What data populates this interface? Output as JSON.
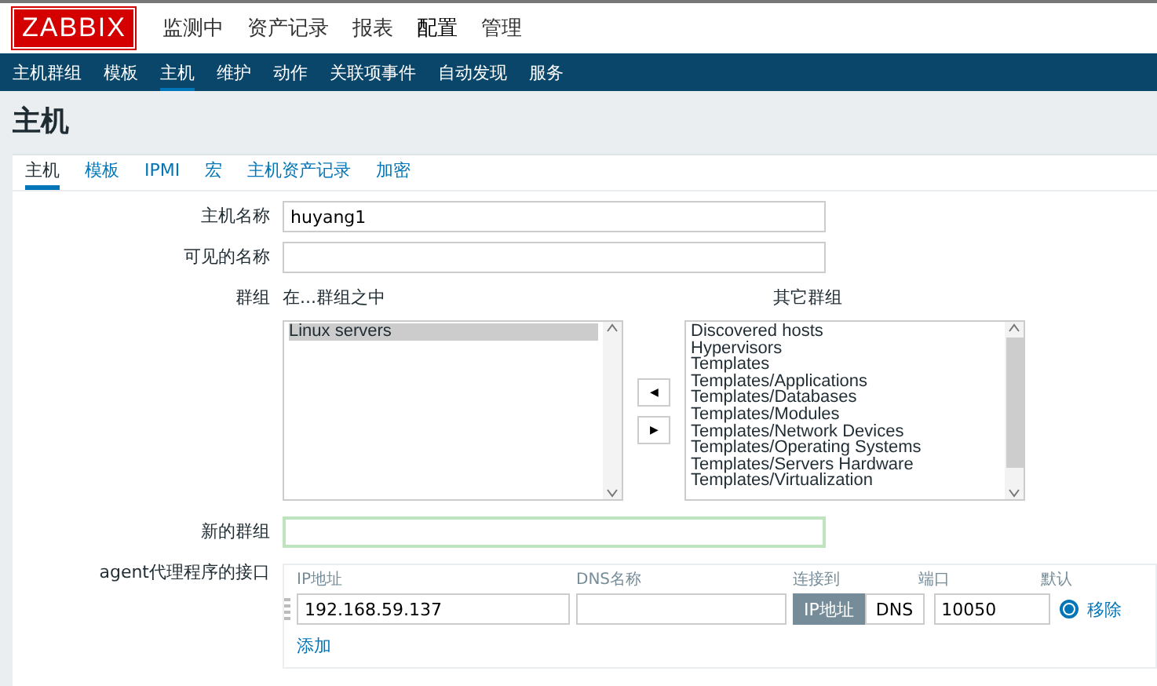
{
  "logo": "ZABBIX",
  "main_menu": [
    {
      "label": "监测中",
      "selected": false
    },
    {
      "label": "资产记录",
      "selected": false
    },
    {
      "label": "报表",
      "selected": false
    },
    {
      "label": "配置",
      "selected": true
    },
    {
      "label": "管理",
      "selected": false
    }
  ],
  "sub_menu": [
    {
      "label": "主机群组",
      "selected": false
    },
    {
      "label": "模板",
      "selected": false
    },
    {
      "label": "主机",
      "selected": true
    },
    {
      "label": "维护",
      "selected": false
    },
    {
      "label": "动作",
      "selected": false
    },
    {
      "label": "关联项事件",
      "selected": false
    },
    {
      "label": "自动发现",
      "selected": false
    },
    {
      "label": "服务",
      "selected": false
    }
  ],
  "page_title": "主机",
  "tabs": [
    {
      "label": "主机",
      "selected": true
    },
    {
      "label": "模板",
      "selected": false
    },
    {
      "label": "IPMI",
      "selected": false
    },
    {
      "label": "宏",
      "selected": false
    },
    {
      "label": "主机资产记录",
      "selected": false
    },
    {
      "label": "加密",
      "selected": false
    }
  ],
  "form": {
    "host_name": {
      "label": "主机名称",
      "value": "huyang1"
    },
    "visible_name": {
      "label": "可见的名称"
    },
    "groups": {
      "label": "群组",
      "in_groups_label": "在...群组之中",
      "in_groups": [
        {
          "label": "Linux servers",
          "selected": true
        }
      ],
      "other_groups_label": "其它群组",
      "other_groups": [
        {
          "label": "Discovered hosts",
          "selected": false
        },
        {
          "label": "Hypervisors",
          "selected": false
        },
        {
          "label": "Templates",
          "selected": false
        },
        {
          "label": "Templates/Applications",
          "selected": false
        },
        {
          "label": "Templates/Databases",
          "selected": false
        },
        {
          "label": "Templates/Modules",
          "selected": false
        },
        {
          "label": "Templates/Network Devices",
          "selected": false
        },
        {
          "label": "Templates/Operating Systems",
          "selected": false
        },
        {
          "label": "Templates/Servers Hardware",
          "selected": false
        },
        {
          "label": "Templates/Virtualization",
          "selected": false
        }
      ],
      "move_left": "◀",
      "move_right": "▶"
    },
    "new_group": {
      "label": "新的群组"
    },
    "agent_interfaces": {
      "label": "agent代理程序的接口",
      "columns": [
        "IP地址",
        "DNS名称",
        "连接到",
        "端口",
        "默认"
      ],
      "rows": [
        {
          "ip": "192.168.59.137",
          "connect": [
            {
              "label": "IP地址",
              "selected": true
            },
            {
              "label": "DNS",
              "selected": false
            }
          ],
          "port": "10050",
          "default": true,
          "remove": "移除"
        }
      ],
      "add": "添加"
    }
  }
}
